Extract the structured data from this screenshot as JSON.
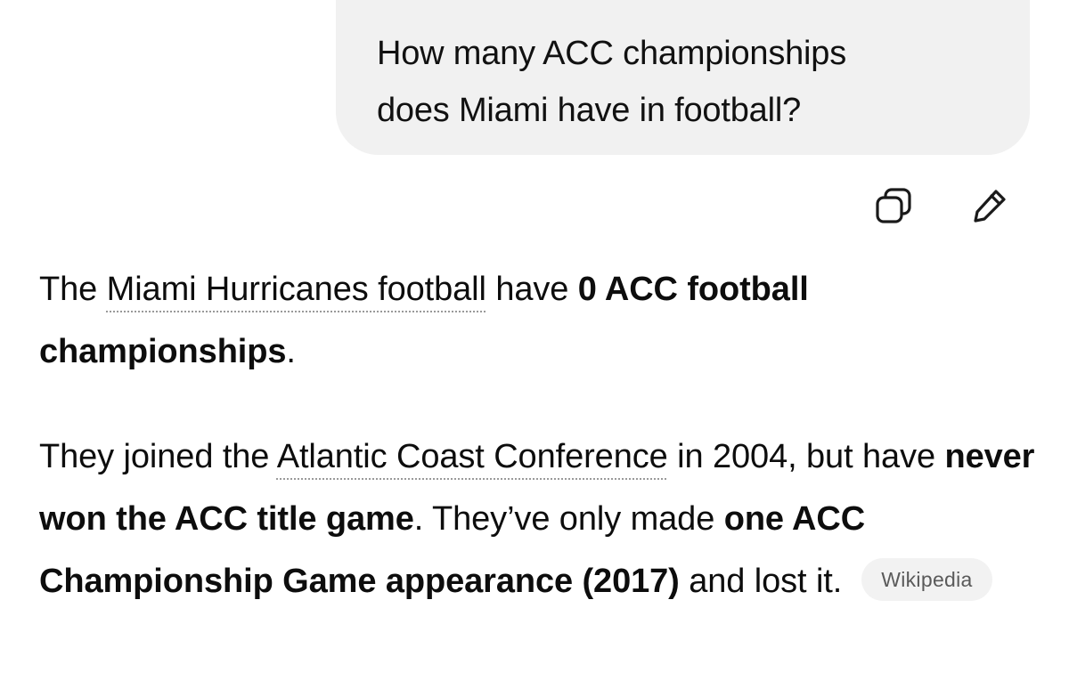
{
  "user_message": {
    "line1": "How many ACC championships",
    "line2": "does Miami have in football?"
  },
  "actions": {
    "copy_icon": "copy-icon",
    "edit_icon": "pencil-icon"
  },
  "answer": {
    "p1": {
      "t1": "The ",
      "link1": "Miami Hurricanes football",
      "t2": " have ",
      "bold1": "0 ACC football championships",
      "t3": "."
    },
    "p2": {
      "t1": "They joined the ",
      "link1": "Atlantic Coast Conference",
      "t2": " in 2004, but have ",
      "bold1": "never won the ACC title game",
      "t3": ". They’ve only made ",
      "bold2": "one ACC Championship Game appearance (2017)",
      "t4": " and lost it."
    },
    "source_label": "Wikipedia"
  }
}
